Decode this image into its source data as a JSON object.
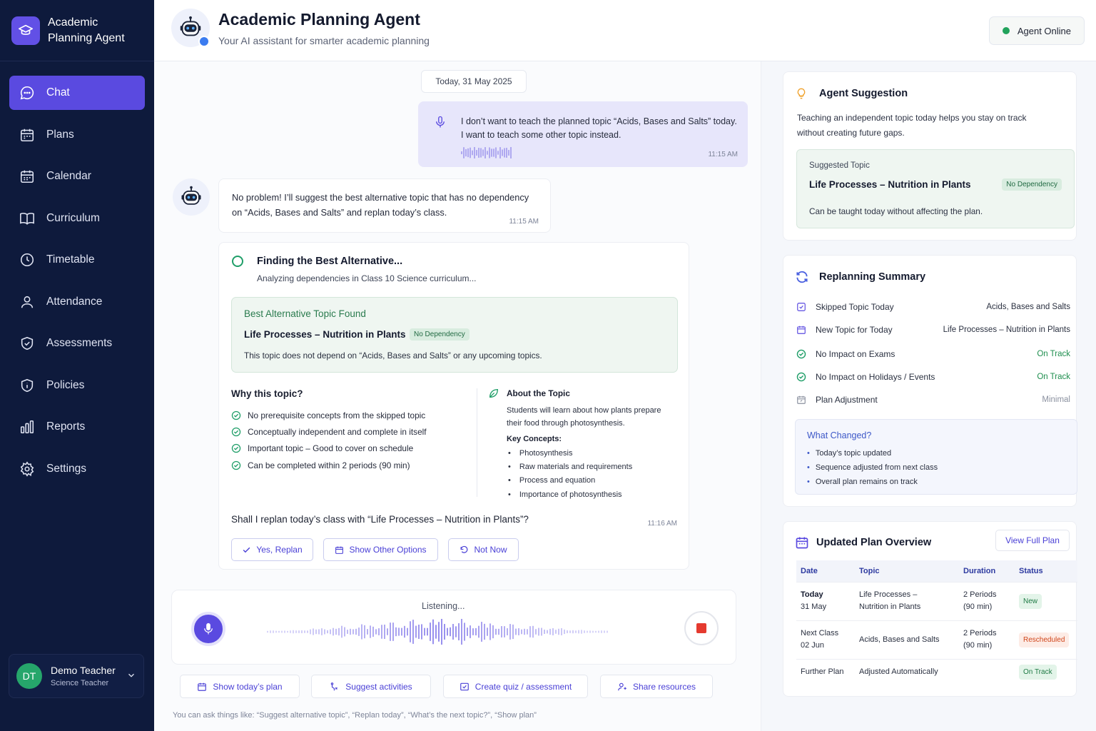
{
  "app": {
    "brand": [
      "Academic",
      "Planning Agent"
    ],
    "title": "Academic Planning Agent",
    "subtitle": "Your AI assistant for smarter academic planning",
    "status": "Agent Online"
  },
  "sidebar": {
    "items": [
      {
        "label": "Chat",
        "icon": "chat-icon",
        "active": true
      },
      {
        "label": "Plans",
        "icon": "plans-icon"
      },
      {
        "label": "Calendar",
        "icon": "calendar-icon"
      },
      {
        "label": "Curriculum",
        "icon": "book-icon"
      },
      {
        "label": "Timetable",
        "icon": "clock-icon"
      },
      {
        "label": "Attendance",
        "icon": "user-icon"
      },
      {
        "label": "Assessments",
        "icon": "shield-check-icon"
      },
      {
        "label": "Policies",
        "icon": "shield-info-icon"
      },
      {
        "label": "Reports",
        "icon": "bar-chart-icon"
      },
      {
        "label": "Settings",
        "icon": "gear-icon"
      }
    ],
    "user": {
      "initials": "DT",
      "name": "Demo Teacher",
      "role": "Science Teacher"
    }
  },
  "chat": {
    "date": "Today, 31 May 2025",
    "user_message": {
      "lines": [
        "I don’t want to teach the planned topic “Acids, Bases and Salts” today.",
        "I want to teach some other topic instead."
      ],
      "time": "11:15 AM"
    },
    "bot_message": {
      "lines": [
        "No problem! I’ll suggest the best alternative topic that has no dependency",
        "on “Acids, Bases and Salts” and replan today’s class."
      ],
      "time": "11:15 AM"
    },
    "card": {
      "title": "Finding the Best Alternative...",
      "subtitle": "Analyzing dependencies in Class 10 Science curriculum...",
      "best_label": "Best Alternative Topic Found",
      "best_topic": "Life Processes – Nutrition in Plants",
      "badge": "No Dependency",
      "best_desc": "This topic does not depend on “Acids, Bases and Salts” or any upcoming topics.",
      "why_title": "Why this topic?",
      "why_items": [
        "No prerequisite concepts from the skipped topic",
        "Conceptually independent and complete in itself",
        "Important topic – Good to cover on schedule",
        "Can be completed within 2 periods (90 min)"
      ],
      "about_title": "About the Topic",
      "about_desc": [
        "Students will learn about how plants prepare",
        "their food through photosynthesis."
      ],
      "key_title": "Key Concepts:",
      "key_items": [
        "Photosynthesis",
        "Raw materials and requirements",
        "Process and equation",
        "Importance of photosynthesis"
      ],
      "question": "Shall I replan today’s class with “Life Processes – Nutrition in Plants”?",
      "time": "11:16 AM",
      "buttons": {
        "yes": "Yes, Replan",
        "other": "Show Other Options",
        "not_now": "Not Now"
      }
    },
    "listening": "Listening...",
    "quick_actions": {
      "plan": "Show today’s plan",
      "activities": "Suggest activities",
      "quiz": "Create quiz / assessment",
      "share": "Share resources"
    },
    "hint": "You can ask things like: “Suggest alternative topic”, “Replan today”, “What’s the next topic?”, “Show plan”"
  },
  "suggestion": {
    "title": "Agent Suggestion",
    "desc": [
      "Teaching an independent topic today helps you stay on track",
      "without creating future gaps."
    ],
    "label": "Suggested Topic",
    "topic": "Life Processes – Nutrition in Plants",
    "badge": "No Dependency",
    "note": "Can be taught today without affecting the plan."
  },
  "replanning": {
    "title": "Replanning Summary",
    "rows": [
      {
        "label": "Skipped Topic Today",
        "value": "Acids, Bases and Salts",
        "tone": "normal"
      },
      {
        "label": "New Topic for Today",
        "value": "Life Processes – Nutrition in Plants",
        "tone": "normal"
      },
      {
        "label": "No Impact on Exams",
        "value": "On Track",
        "tone": "green"
      },
      {
        "label": "No Impact on Holidays / Events",
        "value": "On Track",
        "tone": "green"
      },
      {
        "label": "Plan Adjustment",
        "value": "Minimal",
        "tone": "gray"
      }
    ],
    "changed_title": "What Changed?",
    "changed_items": [
      "Today’s topic updated",
      "Sequence adjusted from next class",
      "Overall plan remains on track"
    ]
  },
  "plan_overview": {
    "title": "Updated Plan Overview",
    "view_btn": "View Full Plan",
    "headers": {
      "date": "Date",
      "topic": "Topic",
      "duration": "Duration",
      "status": "Status"
    },
    "rows": [
      {
        "date": "Today",
        "date2": "31 May",
        "topic": "Life Processes –",
        "topic2": "Nutrition in Plants",
        "dur": "2 Periods",
        "dur2": "(90 min)",
        "status": "New"
      },
      {
        "date": "Next Class",
        "date2": "02 Jun",
        "topic": "Acids, Bases and Salts",
        "dur": "2 Periods",
        "dur2": "(90 min)",
        "status": "Rescheduled"
      },
      {
        "date": "Further Plan",
        "topic": "Adjusted Automatically",
        "status": "On Track"
      }
    ]
  },
  "colors": {
    "sidebar": "#0e1a3c",
    "accent": "#5a4ae0",
    "green": "#1f8f4f",
    "orange": "#d0451a"
  }
}
